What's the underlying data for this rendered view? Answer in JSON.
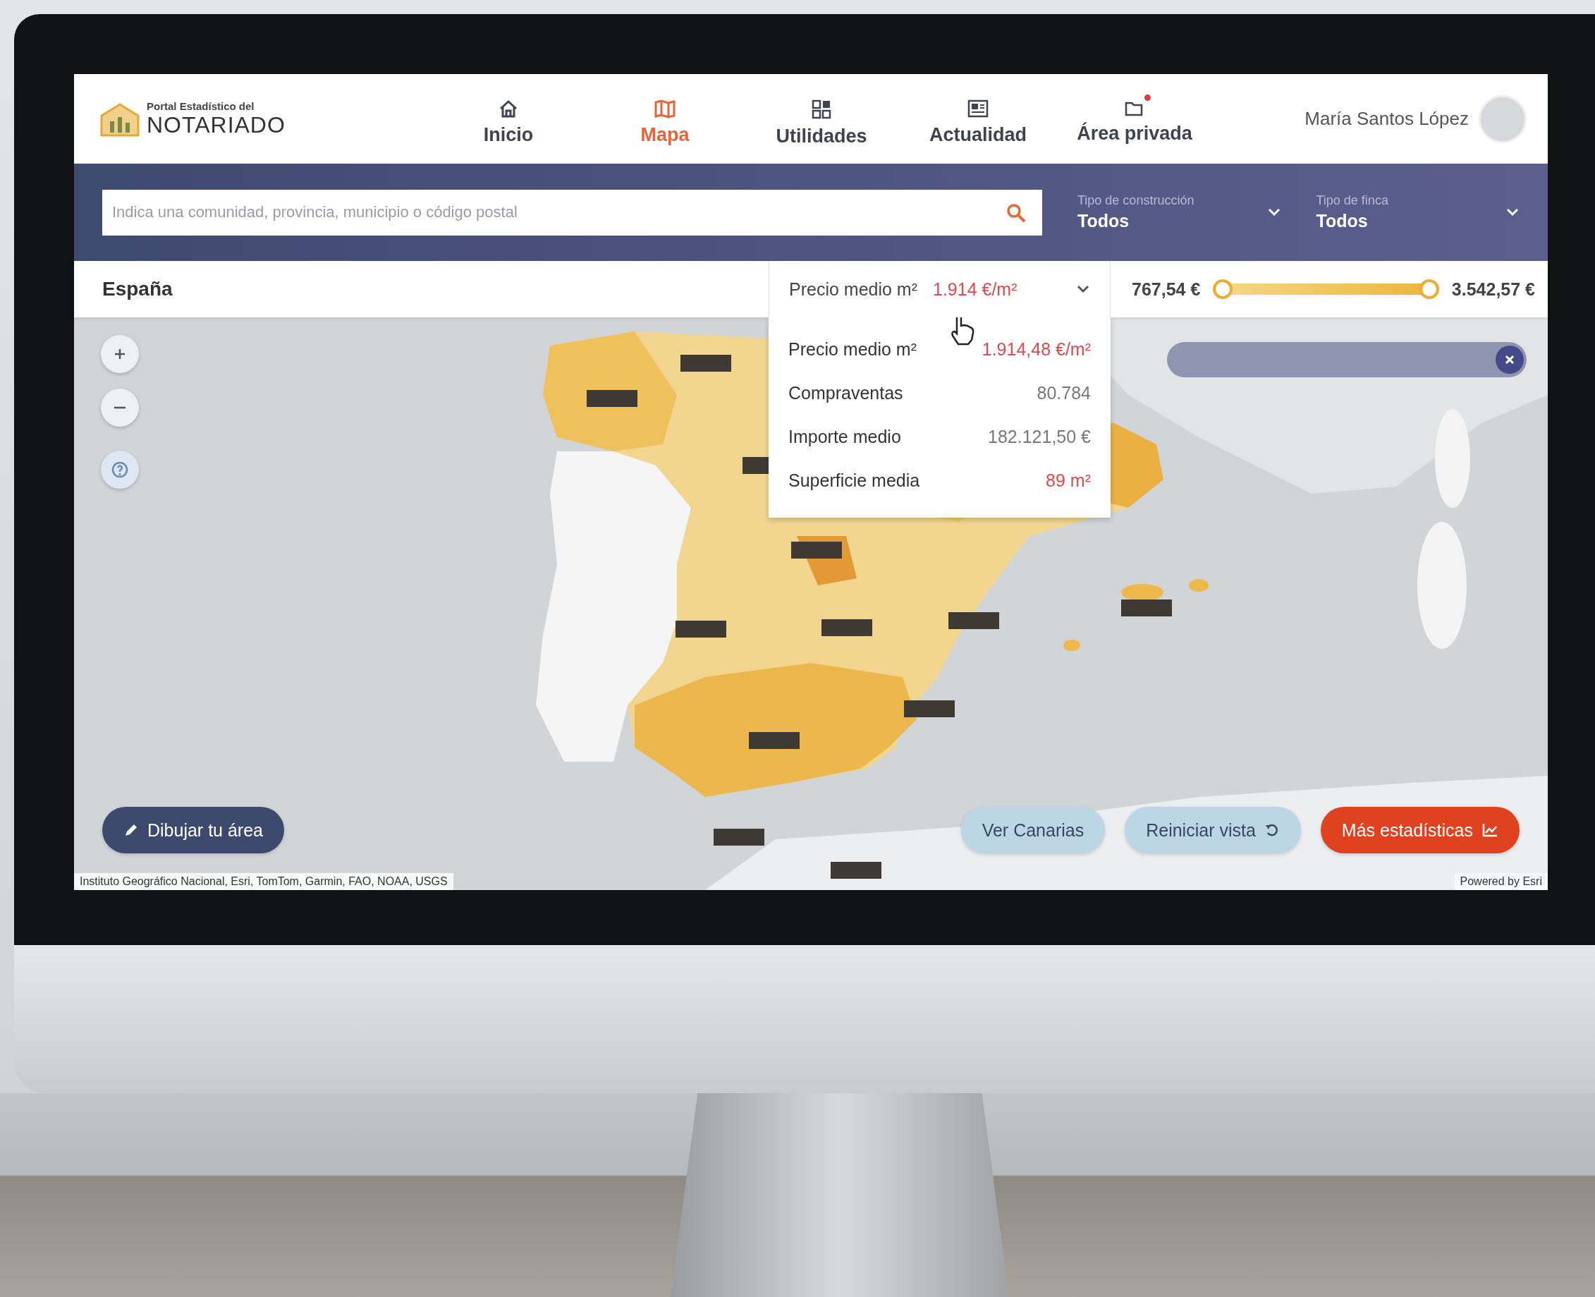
{
  "header": {
    "logo": {
      "line1": "Portal Estadístico del",
      "line2": "NOTARIADO"
    },
    "nav": [
      {
        "label": "Inicio",
        "selected": false,
        "notification": false
      },
      {
        "label": "Mapa",
        "selected": true,
        "notification": false
      },
      {
        "label": "Utilidades",
        "selected": false,
        "notification": false
      },
      {
        "label": "Actualidad",
        "selected": false,
        "notification": false
      },
      {
        "label": "Área privada",
        "selected": false,
        "notification": true
      }
    ],
    "user": {
      "name": "María Santos López"
    }
  },
  "filter_bar": {
    "search": {
      "placeholder": "Indica una comunidad, provincia, municipio o código postal"
    },
    "filters": [
      {
        "label": "Tipo de construcción",
        "value": "Todos"
      },
      {
        "label": "Tipo de finca",
        "value": "Todos"
      }
    ]
  },
  "summary_bar": {
    "location": "España",
    "metric": {
      "label": "Precio medio m²",
      "value": "1.914 €/m²"
    },
    "range": {
      "min_label": "767,54 €",
      "max_label": "3.542,57 €",
      "level": 1
    }
  },
  "metric_menu": [
    {
      "label": "Precio medio m²",
      "value": "1.914,48 €/m²",
      "highlighted": true
    },
    {
      "label": "Compraventas",
      "value": "80.784",
      "highlighted": false
    },
    {
      "label": "Importe medio",
      "value": "182.121,50 €",
      "highlighted": false
    },
    {
      "label": "Superficie media",
      "value": "89 m²",
      "highlighted": true
    }
  ],
  "map": {
    "buttons": [
      {
        "label": "Dibujar tu área",
        "kind": "draw"
      },
      {
        "label": "Ver Canarias",
        "kind": "light"
      },
      {
        "label": "Reiniciar vista",
        "kind": "reset"
      },
      {
        "label": "Más estadísticas",
        "kind": "primary"
      }
    ],
    "attribution": "Instituto Geográfico Nacional, Esri, TomTom, Garmin, FAO, NOAA, USGS",
    "powered_by": "Powered by Esri"
  }
}
